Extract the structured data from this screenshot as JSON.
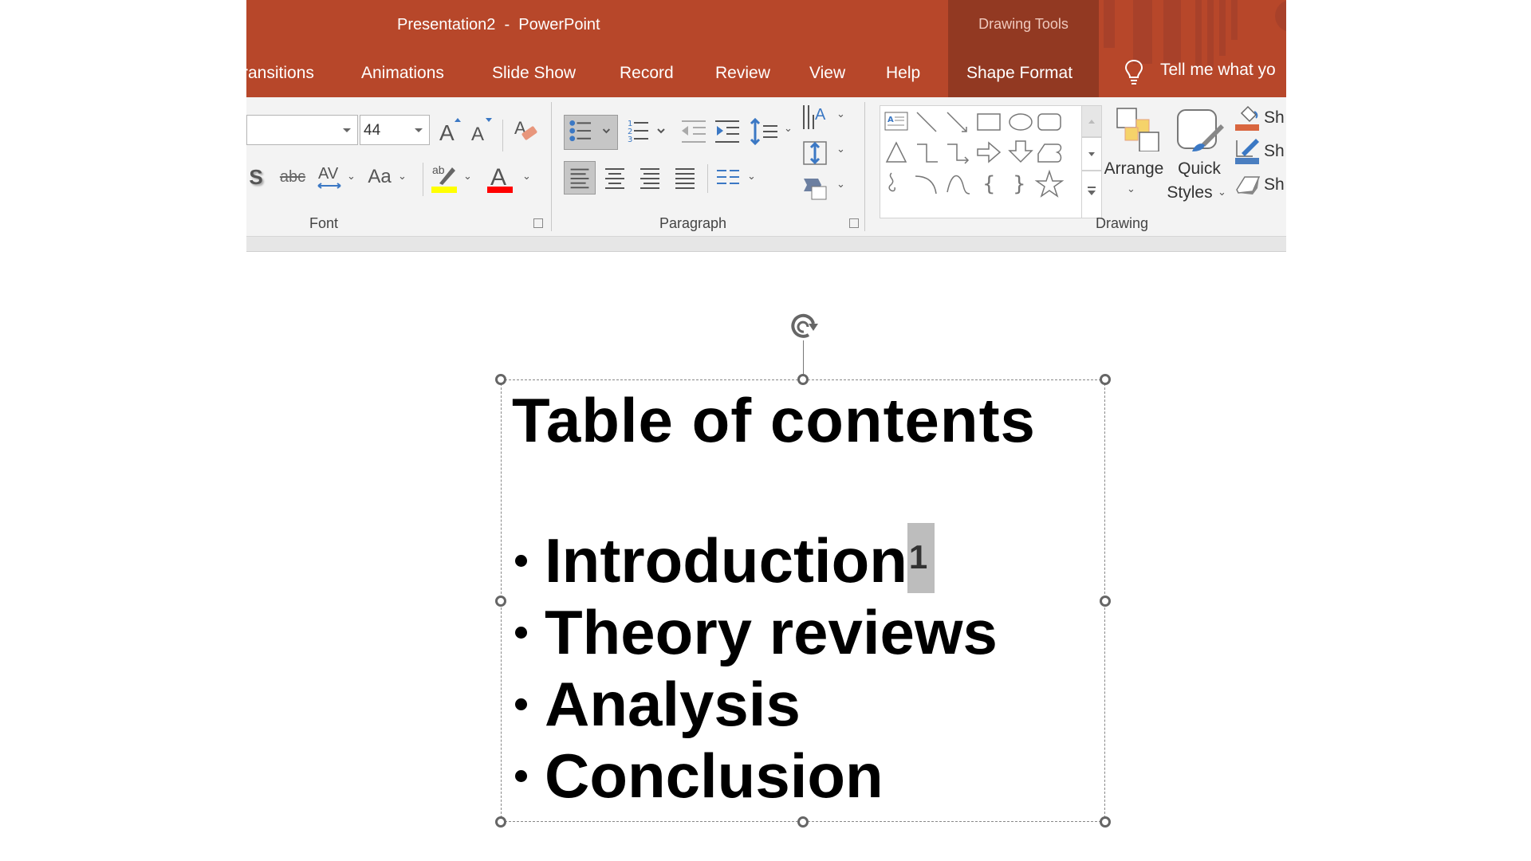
{
  "window": {
    "title": "Presentation2  -  PowerPoint",
    "contextual_group": "Drawing Tools"
  },
  "tabs": [
    {
      "label": "Transitions",
      "visible_text": "ransitions"
    },
    {
      "label": "Animations"
    },
    {
      "label": "Slide Show"
    },
    {
      "label": "Record"
    },
    {
      "label": "Review"
    },
    {
      "label": "View"
    },
    {
      "label": "Help"
    },
    {
      "label": "Shape Format",
      "contextual": true
    }
  ],
  "tell_me": {
    "icon": "lightbulb-icon",
    "text": "Tell me what yo"
  },
  "ribbon": {
    "font": {
      "label": "Font",
      "font_name": "",
      "font_size": "44",
      "buttons": [
        "increase-font-size",
        "decrease-font-size",
        "clear-formatting",
        "text-shadow",
        "strikethrough",
        "character-spacing",
        "change-case",
        "highlight-color",
        "font-color"
      ],
      "highlight_color": "#ffff00",
      "font_color": "#ff0000",
      "glyphs": {
        "grow": "A",
        "shrink": "A",
        "shadow": "S",
        "strike": "abc",
        "spacing": "AV",
        "case": "Aa",
        "highlight": "ab",
        "color": "A"
      }
    },
    "paragraph": {
      "label": "Paragraph",
      "bullets_active": true,
      "align_left_active": true
    },
    "drawing": {
      "label": "Drawing",
      "arrange": "Arrange",
      "quick_styles_1": "Quick",
      "quick_styles_2": "Styles",
      "shape_fill": "Sh",
      "shape_outline": "Sh",
      "shape_effects": "Sh",
      "fill_color": "#d9663f",
      "outline_color": "#4a7ec0"
    }
  },
  "slide": {
    "title": "Table of contents",
    "bullets": [
      "Introduction",
      "Theory reviews",
      "Analysis",
      "Conclusion"
    ],
    "footnote_ref": "1"
  }
}
